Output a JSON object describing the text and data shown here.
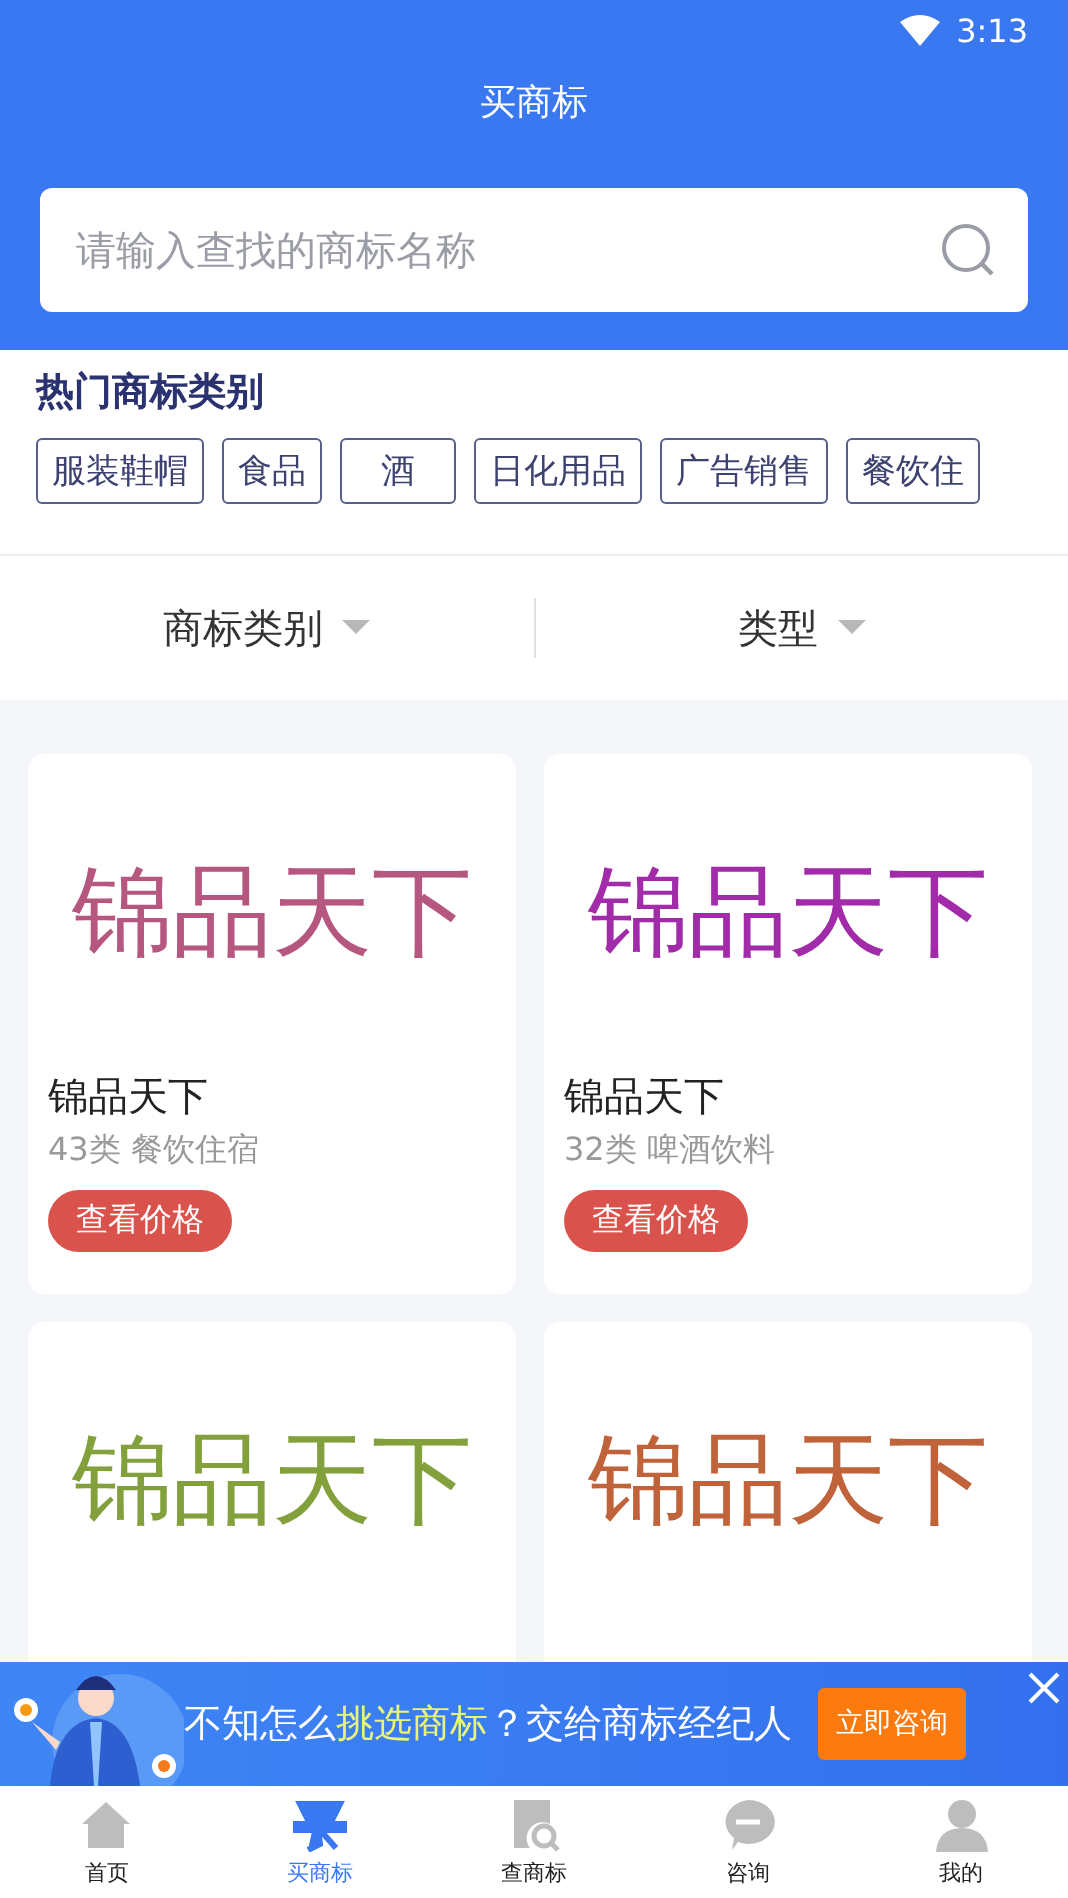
{
  "status_bar": {
    "time": "3:13"
  },
  "header": {
    "title": "买商标",
    "search": {
      "placeholder": "请输入查找的商标名称"
    }
  },
  "hot_categories": {
    "title": "热门商标类别",
    "tags": [
      "服装鞋帽",
      "食品",
      "酒",
      "日化用品",
      "广告销售",
      "餐饮住"
    ]
  },
  "filters": [
    {
      "label": "商标类别"
    },
    {
      "label": "类型"
    }
  ],
  "cards": [
    {
      "logo": "锦品天下",
      "color": "#b5577f",
      "name": "锦品天下",
      "category": "43类 餐饮住宿",
      "button": "查看价格"
    },
    {
      "logo": "锦品天下",
      "color": "#a12ba8",
      "name": "锦品天下",
      "category": "32类 啤酒饮料",
      "button": "查看价格"
    },
    {
      "logo": "锦品天下",
      "color": "#82a03c"
    },
    {
      "logo": "锦品天下",
      "color": "#c0623a"
    }
  ],
  "banner": {
    "before": "不知怎么",
    "highlight": "挑选商标",
    "after": "？交给商标经纪人",
    "button": "立即咨询"
  },
  "tab_bar": [
    {
      "label": "首页",
      "kind": "home",
      "selected": false
    },
    {
      "label": "买商标",
      "kind": "buy",
      "selected": true
    },
    {
      "label": "查商标",
      "kind": "search",
      "selected": false
    },
    {
      "label": "咨询",
      "kind": "chat",
      "selected": false
    },
    {
      "label": "我的",
      "kind": "user",
      "selected": false
    }
  ]
}
